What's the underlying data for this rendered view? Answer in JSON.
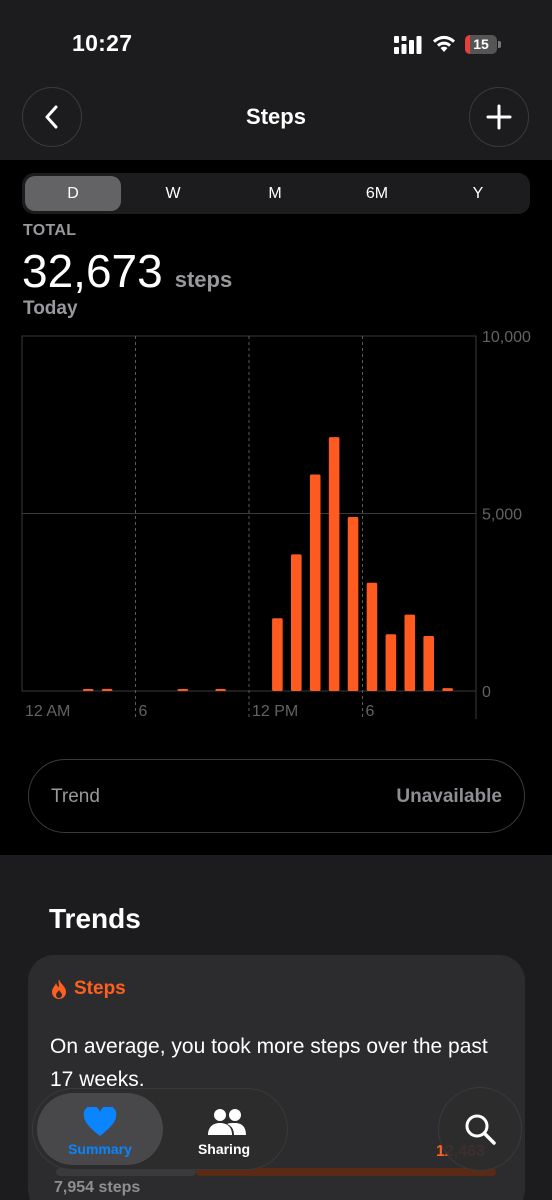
{
  "status_bar": {
    "time": "10:27",
    "battery": "15",
    "battery_level": 0.15
  },
  "header": {
    "title": "Steps"
  },
  "range_tabs": [
    {
      "label": "D",
      "active": true
    },
    {
      "label": "W",
      "active": false
    },
    {
      "label": "M",
      "active": false
    },
    {
      "label": "6M",
      "active": false
    },
    {
      "label": "Y",
      "active": false
    }
  ],
  "summary": {
    "total_label": "TOTAL",
    "total_value": "32,673",
    "total_unit": "steps",
    "date_label": "Today"
  },
  "chart_data": {
    "type": "bar",
    "x_tick_labels": [
      "12 AM",
      "6",
      "12 PM",
      "6"
    ],
    "y_tick_labels": [
      "10,000",
      "5,000",
      "0"
    ],
    "ylim": [
      0,
      10000
    ],
    "grid": true,
    "bar_color": "#ff5a1f",
    "hours": [
      0,
      1,
      2,
      3,
      4,
      5,
      6,
      7,
      8,
      9,
      10,
      11,
      12,
      13,
      14,
      15,
      16,
      17,
      18,
      19,
      20,
      21,
      22,
      23
    ],
    "values": [
      0,
      0,
      0,
      20,
      60,
      0,
      0,
      0,
      25,
      0,
      35,
      0,
      0,
      2050,
      3850,
      6100,
      7150,
      4900,
      3050,
      1600,
      2150,
      1550,
      80,
      0
    ]
  },
  "trend": {
    "label": "Trend",
    "value": "Unavailable"
  },
  "trends_section": {
    "title": "Trends",
    "card": {
      "title": "Steps",
      "text": "On average, you took more steps over the past 17 weeks.",
      "left_value": "7,954 steps",
      "right_value": "12,463"
    }
  },
  "tab_bar": {
    "tabs": [
      {
        "label": "Summary",
        "active": true
      },
      {
        "label": "Sharing",
        "active": false
      }
    ]
  },
  "colors": {
    "accent": "#ff5f1f",
    "tab_active": "#0a84ff",
    "background": "#000000",
    "surface": "#1c1c1e"
  }
}
